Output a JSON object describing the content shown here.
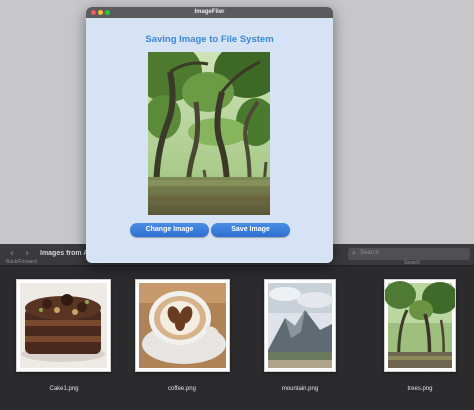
{
  "app": {
    "window_title": "ImageFiler",
    "heading": "Saving Image to File System",
    "change_button": "Change Image",
    "save_button": "Save Image"
  },
  "finder": {
    "title": "Images from App",
    "nav_label": "Back/Forward",
    "search_placeholder": "Search",
    "search_label": "Search",
    "files": [
      {
        "name": "Cake1.png",
        "icon": "cake-image"
      },
      {
        "name": "coffee.png",
        "icon": "coffee-image"
      },
      {
        "name": "mountain.png",
        "icon": "mountain-image"
      },
      {
        "name": "trees.png",
        "icon": "trees-image"
      }
    ]
  },
  "colors": {
    "accent": "#3a86d8",
    "button": "#3578d8",
    "window_bg": "#d6e3f5",
    "finder_bg": "#2b2b2d"
  }
}
